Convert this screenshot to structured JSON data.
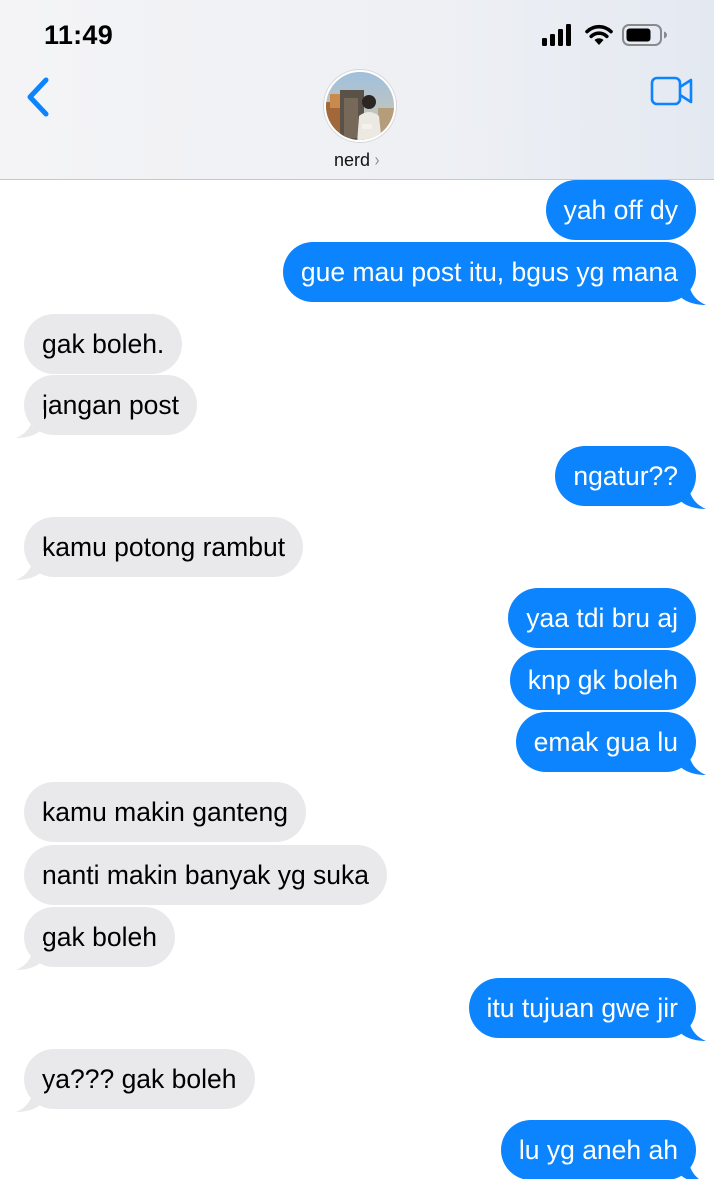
{
  "status_bar": {
    "time": "11:49"
  },
  "header": {
    "contact_name": "nerd",
    "chevron": "›"
  },
  "icons": {
    "back": "chevron-left-icon",
    "video": "video-camera-icon",
    "signal": "cellular-signal-icon",
    "wifi": "wifi-icon",
    "battery": "battery-icon"
  },
  "colors": {
    "accent": "#0b84fe",
    "sent_bubble": "#0b84fe",
    "received_bubble": "#e9e9eb"
  },
  "messages": [
    {
      "text": "yah off dy",
      "sender": "me",
      "tail": false
    },
    {
      "text": "gue mau post itu, bgus yg mana",
      "sender": "me",
      "tail": true
    },
    {
      "text": "gak boleh.",
      "sender": "them",
      "tail": false
    },
    {
      "text": "jangan post",
      "sender": "them",
      "tail": true
    },
    {
      "text": "ngatur??",
      "sender": "me",
      "tail": true
    },
    {
      "text": "kamu potong rambut",
      "sender": "them",
      "tail": true
    },
    {
      "text": "yaa tdi bru aj",
      "sender": "me",
      "tail": false
    },
    {
      "text": "knp gk boleh",
      "sender": "me",
      "tail": false
    },
    {
      "text": "emak gua lu",
      "sender": "me",
      "tail": true
    },
    {
      "text": "kamu makin ganteng",
      "sender": "them",
      "tail": false
    },
    {
      "text": "nanti makin banyak yg suka",
      "sender": "them",
      "tail": false
    },
    {
      "text": "gak boleh",
      "sender": "them",
      "tail": true
    },
    {
      "text": "itu tujuan gwe jir",
      "sender": "me",
      "tail": true
    },
    {
      "text": "ya??? gak boleh",
      "sender": "them",
      "tail": true
    },
    {
      "text": "lu yg aneh ah",
      "sender": "me",
      "tail": true
    }
  ]
}
